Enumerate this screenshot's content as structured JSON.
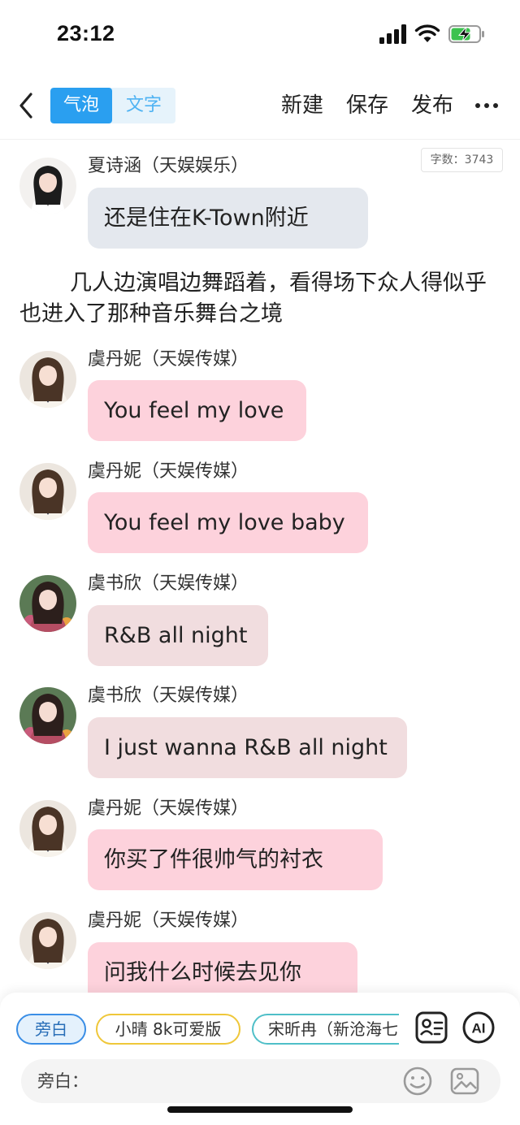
{
  "status_bar": {
    "time": "23:12",
    "icons": [
      "signal-icon",
      "wifi-icon",
      "battery-charging-icon"
    ],
    "battery_color": "#3cc24f"
  },
  "nav": {
    "back_icon": "chevron-left-icon",
    "mode_bubble": "气泡",
    "mode_text": "文字",
    "new_label": "新建",
    "save_label": "保存",
    "publish_label": "发布",
    "more_icon": "more-horizontal-icon"
  },
  "word_count": "字数：3743",
  "messages": [
    {
      "sender": "夏诗涵（天娱娱乐）",
      "text": "还是住在K-Town附近",
      "bubble_color": "#e4e8ee"
    },
    {
      "sender": "虞丹妮（天娱传媒）",
      "text": "You feel my love",
      "bubble_color": "#fdd2dc"
    },
    {
      "sender": "虞丹妮（天娱传媒）",
      "text": "You feel my love baby",
      "bubble_color": "#fdd2dc"
    },
    {
      "sender": "虞书欣（天娱传媒）",
      "text": "R&B all night",
      "bubble_color": "#f1dddf"
    },
    {
      "sender": "虞书欣（天娱传媒）",
      "text": "I just wanna R&B all night",
      "bubble_color": "#f1dddf"
    },
    {
      "sender": "虞丹妮（天娱传媒）",
      "text": "你买了件很帅气的衬衣",
      "bubble_color": "#fdd2dc"
    },
    {
      "sender": "虞丹妮（天娱传媒）",
      "text": "问我什么时候去见你",
      "bubble_color": "#fdd2dc"
    }
  ],
  "narration": "几人边演唱边舞蹈着，看得场下众人得似乎也进入了那种音乐舞台之境",
  "bottom": {
    "chips": [
      "旁白",
      "小晴 8k可爱版",
      "宋昕冉（新沧海七"
    ],
    "contact_icon": "contact-card-icon",
    "ai_label": "AI",
    "input_placeholder": "旁白：",
    "emoji_icon": "emoji-icon",
    "image_icon": "image-icon"
  },
  "colors": {
    "accent": "#2a9ff0",
    "bubble_pink": "#fdd2dc",
    "bubble_gray": "#e4e8ee"
  }
}
